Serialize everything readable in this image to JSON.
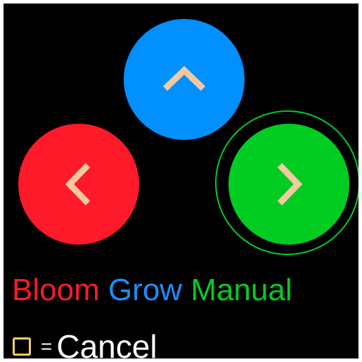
{
  "colors": {
    "background": "#000000",
    "up_button": "#0090ff",
    "left_button": "#ff1a2a",
    "right_button": "#00cc22",
    "arrow": "#f5c9a0",
    "bloom": "#ff1a2a",
    "grow": "#1a8fff",
    "manual": "#00cc22",
    "cancel_square": "#f0d060",
    "text": "#ffffff"
  },
  "buttons": {
    "up": {
      "icon": "chevron-up-icon"
    },
    "left": {
      "icon": "chevron-left-icon"
    },
    "right": {
      "icon": "chevron-right-icon",
      "selected": true
    }
  },
  "modes": {
    "bloom": "Bloom",
    "grow": "Grow",
    "manual": "Manual"
  },
  "legend": {
    "icon": "square-icon",
    "equals": "=",
    "cancel": "Cancel"
  }
}
